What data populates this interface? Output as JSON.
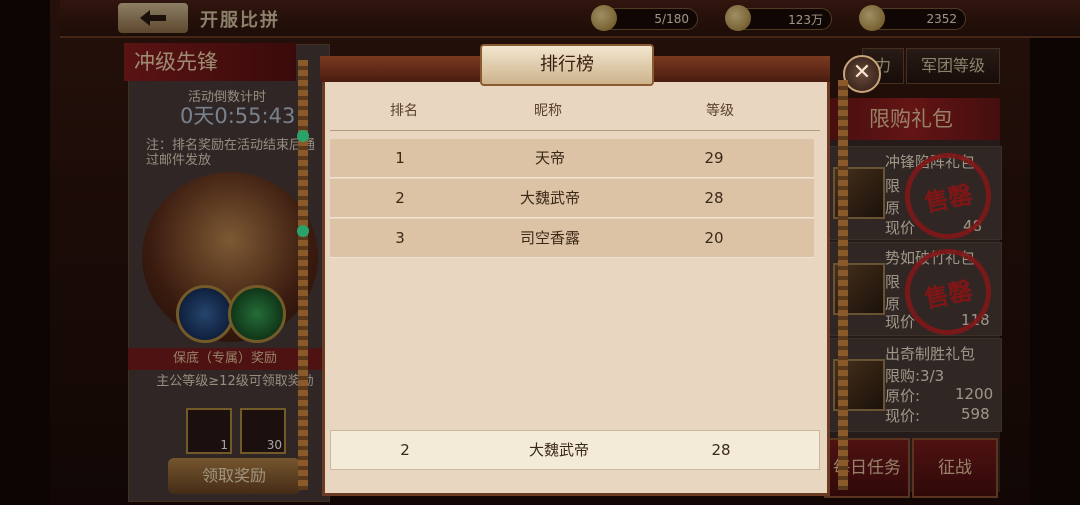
{
  "topbar": {
    "title": "开服比拼",
    "resources": [
      {
        "icon": "stamina-icon",
        "value": "5/180"
      },
      {
        "icon": "coin-icon",
        "value": "123万"
      },
      {
        "icon": "ingot-icon",
        "value": "2352"
      }
    ]
  },
  "left": {
    "title": "冲级先锋",
    "countdown_label": "活动倒数计时",
    "countdown": "0天0:55:43",
    "note": "注：排名奖励在活动结束后通过邮件发放",
    "banner": "保底（专属）奖励",
    "requirement": "主公等级≥12级可领取奖励",
    "rewards": [
      {
        "count": "1"
      },
      {
        "count": "30"
      }
    ],
    "claim_label": "领取奖励"
  },
  "tabs": [
    "力",
    "军团等级"
  ],
  "shop": {
    "title": "限购礼包",
    "gifts": [
      {
        "name": "冲锋陷阵礼包",
        "limit": "限",
        "orig": "原",
        "now": "现价",
        "price": "48",
        "sold": "售罄"
      },
      {
        "name": "势如破竹礼包",
        "limit": "限",
        "orig": "原",
        "now": "现价",
        "price": "118",
        "sold": "售罄"
      },
      {
        "name": "出奇制胜礼包",
        "limit": "限购:3/3",
        "orig": "原价:",
        "orig_price": "1200",
        "now": "现价:",
        "price": "598"
      }
    ],
    "buttons": [
      "每日任务",
      "征战"
    ]
  },
  "modal": {
    "title": "排行榜",
    "headers": [
      "排名",
      "昵称",
      "等级"
    ],
    "rows": [
      {
        "rank": "1",
        "name": "天帝",
        "level": "29"
      },
      {
        "rank": "2",
        "name": "大魏武帝",
        "level": "28"
      },
      {
        "rank": "3",
        "name": "司空香露",
        "level": "20"
      }
    ],
    "self": {
      "rank": "2",
      "name": "大魏武帝",
      "level": "28"
    },
    "close": "✕"
  }
}
